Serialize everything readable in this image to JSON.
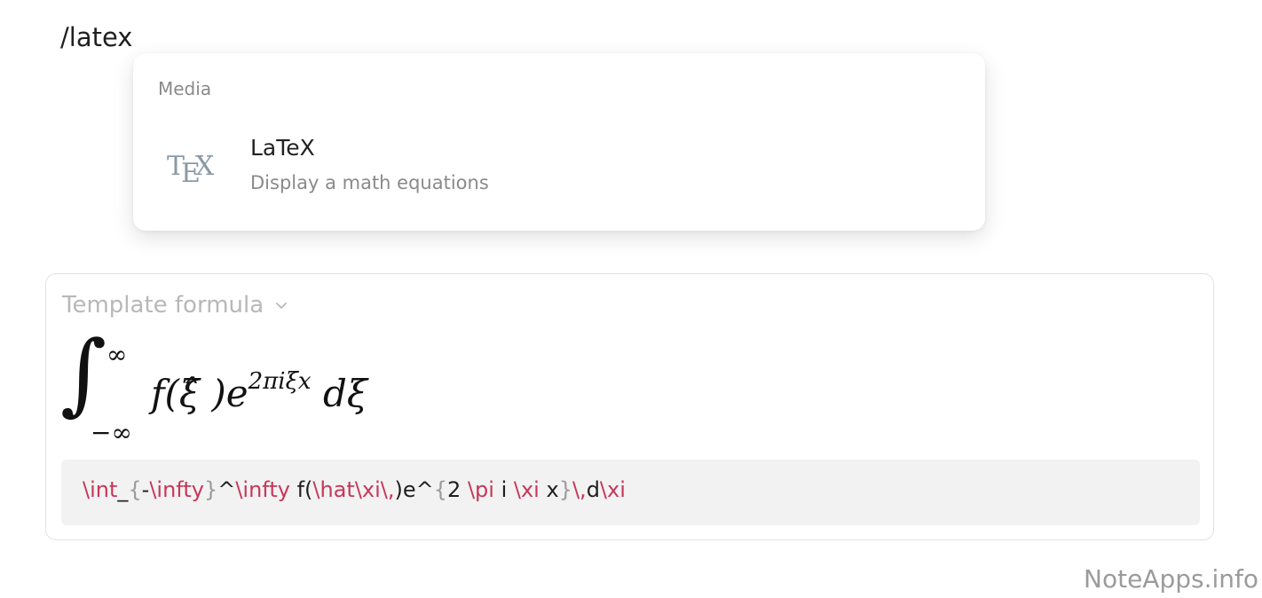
{
  "editor": {
    "slash_command": "/latex"
  },
  "popup": {
    "section_label": "Media",
    "item": {
      "icon": "tex-logo-icon",
      "title": "LaTeX",
      "description": "Display a math equations"
    }
  },
  "latex_block": {
    "template_label": "Template formula",
    "code_segments": [
      {
        "text": "\\int",
        "kind": "cmd"
      },
      {
        "text": "_",
        "kind": "plain"
      },
      {
        "text": "{",
        "kind": "brace"
      },
      {
        "text": "-",
        "kind": "plain"
      },
      {
        "text": "\\infty",
        "kind": "cmd"
      },
      {
        "text": "}",
        "kind": "brace"
      },
      {
        "text": "^",
        "kind": "plain"
      },
      {
        "text": "\\infty",
        "kind": "cmd"
      },
      {
        "text": " f(",
        "kind": "plain"
      },
      {
        "text": "\\hat",
        "kind": "cmd"
      },
      {
        "text": "\\xi",
        "kind": "cmd"
      },
      {
        "text": "\\,",
        "kind": "cmd"
      },
      {
        "text": ")e^",
        "kind": "plain"
      },
      {
        "text": "{",
        "kind": "brace"
      },
      {
        "text": "2 ",
        "kind": "plain"
      },
      {
        "text": "\\pi",
        "kind": "cmd"
      },
      {
        "text": " i ",
        "kind": "plain"
      },
      {
        "text": "\\xi",
        "kind": "cmd"
      },
      {
        "text": " x",
        "kind": "plain"
      },
      {
        "text": "}",
        "kind": "brace"
      },
      {
        "text": "\\,",
        "kind": "cmd"
      },
      {
        "text": "d",
        "kind": "plain"
      },
      {
        "text": "\\xi",
        "kind": "cmd"
      }
    ],
    "rendered": {
      "integral_sign": "∫",
      "upper_limit": "∞",
      "lower_limit": "−∞",
      "expression_main": "f(ξ̂ )e",
      "expression_sup": "2πiξx",
      "expression_tail": " dξ"
    }
  },
  "watermark": "NoteApps.info",
  "colors": {
    "latex_command": "#c7375b",
    "brace": "#9a9a9a",
    "muted_text": "#8a8a8a",
    "tex_logo": "#8b9aa5"
  }
}
